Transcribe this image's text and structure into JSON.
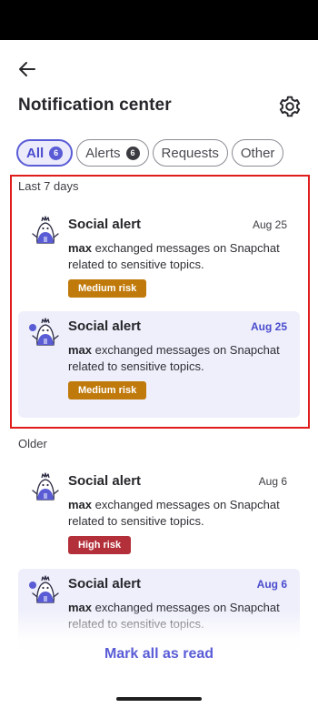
{
  "header": {
    "title": "Notification center",
    "back_icon": "arrow-left-icon",
    "settings_icon": "gear-icon"
  },
  "tabs": [
    {
      "label": "All",
      "count": "6",
      "active": true
    },
    {
      "label": "Alerts",
      "count": "6",
      "active": false
    },
    {
      "label": "Requests",
      "count": "",
      "active": false
    },
    {
      "label": "Other",
      "count": "",
      "active": false
    }
  ],
  "sections": {
    "recent": "Last 7 days",
    "older": "Older"
  },
  "notifications": [
    {
      "title": "Social alert",
      "date": "Aug 25",
      "user": "max",
      "message": " exchanged messages on Snapchat related to sensitive topics.",
      "risk": "Medium risk",
      "risk_color": "#c07a0b",
      "unread": false
    },
    {
      "title": "Social alert",
      "date": "Aug 25",
      "user": "max",
      "message": " exchanged messages on Snapchat related to sensitive topics.",
      "risk": "Medium risk",
      "risk_color": "#c07a0b",
      "unread": true
    },
    {
      "title": "Social alert",
      "date": "Aug 6",
      "user": "max",
      "message": " exchanged messages on Snapchat related to sensitive topics.",
      "risk": "High risk",
      "risk_color": "#b3303a",
      "unread": false
    },
    {
      "title": "Social alert",
      "date": "Aug 6",
      "user": "max",
      "message": " exchanged messages on Snapchat related to sensitive topics.",
      "risk": "",
      "risk_color": "",
      "unread": true
    }
  ],
  "footer": {
    "mark_all_label": "Mark all as read"
  },
  "colors": {
    "accent": "#5a5cd6",
    "highlight_border": "#e01c1c",
    "unread_bg": "#efeffb"
  }
}
